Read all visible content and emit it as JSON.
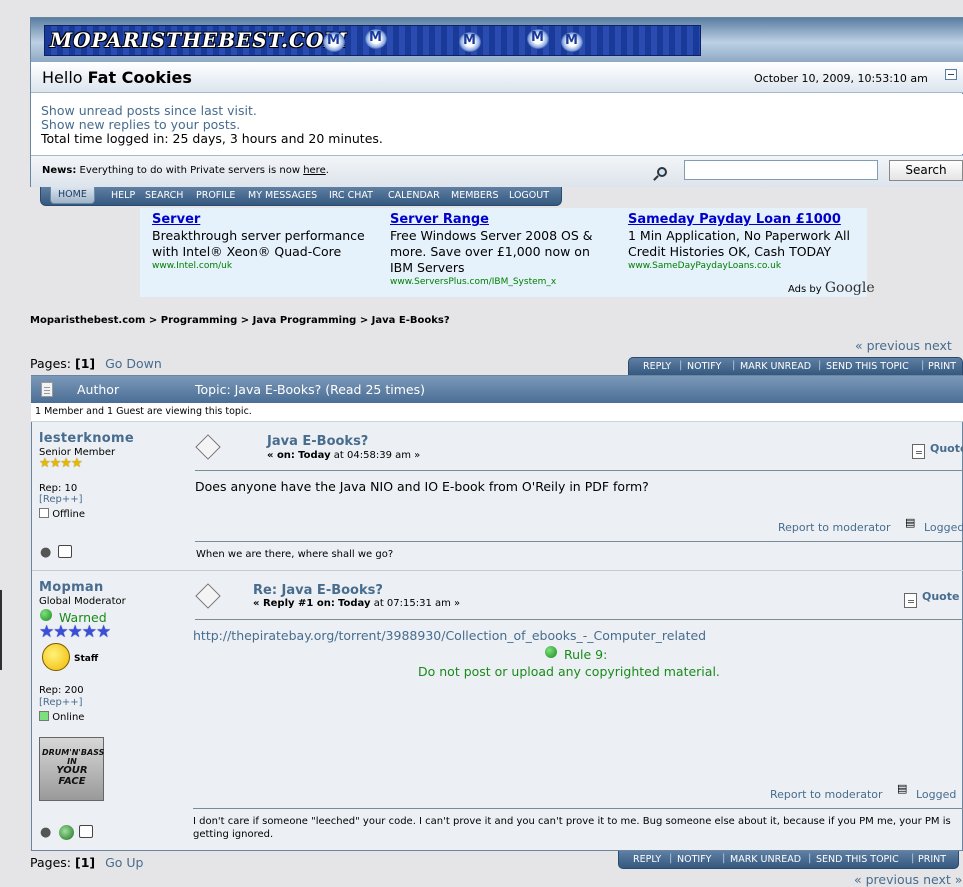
{
  "site": {
    "logo_text": "MOPARISTHEBEST.COM"
  },
  "header": {
    "greeting_prefix": "Hello",
    "username": "Fat Cookies",
    "datetime": "October 10, 2009, 10:53:10 am",
    "unread_link": "Show unread posts since last visit.",
    "replies_link": "Show new replies to your posts.",
    "time_logged": "Total time logged in: 25 days, 3 hours and 20 minutes.",
    "news_label": "News:",
    "news_text": "Everything to do with Private servers is now",
    "news_link": "here",
    "news_end": ".",
    "search_value": "",
    "search_button": "Search"
  },
  "menu": [
    "HOME",
    "HELP",
    "SEARCH",
    "PROFILE",
    "MY MESSAGES",
    "IRC CHAT",
    "CALENDAR",
    "MEMBERS",
    "LOGOUT"
  ],
  "ads": [
    {
      "title": "Server",
      "body": "Breakthrough server performance with Intel® Xeon® Quad-Core",
      "url": "www.Intel.com/uk"
    },
    {
      "title": "Server Range",
      "body": "Free Windows Server 2008 OS & more. Save over £1,000 now on IBM Servers",
      "url": "www.ServersPlus.com/IBM_System_x"
    },
    {
      "title": "Sameday Payday Loan £1000",
      "body": "1 Min Application, No Paperwork All Credit Histories OK, Cash TODAY",
      "url": "www.SameDayPaydayLoans.co.uk"
    }
  ],
  "ads_by": {
    "prefix": "Ads by",
    "brand": "Google"
  },
  "breadcrumb": "Moparisthebest.com > Programming > Java Programming > Java E-Books?",
  "nav": {
    "prev": "« previous",
    "next": "next",
    "next_bottom": "next »",
    "pages_label": "Pages:",
    "page_current": "[1]",
    "go_down": "Go Down",
    "go_up": "Go Up"
  },
  "topic_buttons": [
    "REPLY",
    "NOTIFY",
    "MARK UNREAD",
    "SEND THIS TOPIC",
    "PRINT"
  ],
  "topic": {
    "author_header": "Author",
    "topic_header": "Topic: Java E-Books?  (Read 25 times)",
    "viewing": "1 Member and 1 Guest are viewing this topic."
  },
  "posts": [
    {
      "poster": "lesterknome",
      "rank": "Senior Member",
      "stars": "★★★★",
      "rep": "Rep: 10",
      "rep_link": "[Rep++]",
      "status": "Offline",
      "title": "Java E-Books?",
      "meta_on": "« on:",
      "meta_day": "Today",
      "meta_time": "at 04:58:39 am »",
      "quote": "Quote",
      "body": "Does anyone have the Java NIO and IO E-book from O'Reily in PDF form?",
      "report": "Report to moderator",
      "logged": "Logged",
      "signature": "When we are there, where shall we go?"
    },
    {
      "poster": "Mopman",
      "rank": "Global Moderator",
      "warned": "Warned",
      "stars": "★★★★★",
      "staff": "Staff",
      "rep": "Rep: 200",
      "rep_link": "[Rep++]",
      "status": "Online",
      "avatar_lines": [
        "DRUM'N'BASS",
        "IN",
        "YOUR FACE"
      ],
      "title": "Re: Java E-Books?",
      "meta_on": "« Reply #1 on:",
      "meta_day": "Today",
      "meta_time": "at 07:15:31 am »",
      "quote": "Quote",
      "link": "http://thepiratebay.org/torrent/3988930/Collection_of_ebooks_-_Computer_related",
      "rule": "Rule 9:",
      "rule_text": "Do not post or upload any copyrighted material.",
      "report": "Report to moderator",
      "logged": "Logged",
      "signature": "I don't care if someone \"leeched\" your code. I can't prove it and you can't prove it to me. Bug someone else about it, because if you PM me, your PM is getting ignored."
    }
  ],
  "colors": {
    "link": "#476c8e",
    "header_blue": "#4a6e95",
    "warned_green": "#1a8a1a",
    "ad_title": "#0000cc",
    "ad_url": "#008000"
  }
}
